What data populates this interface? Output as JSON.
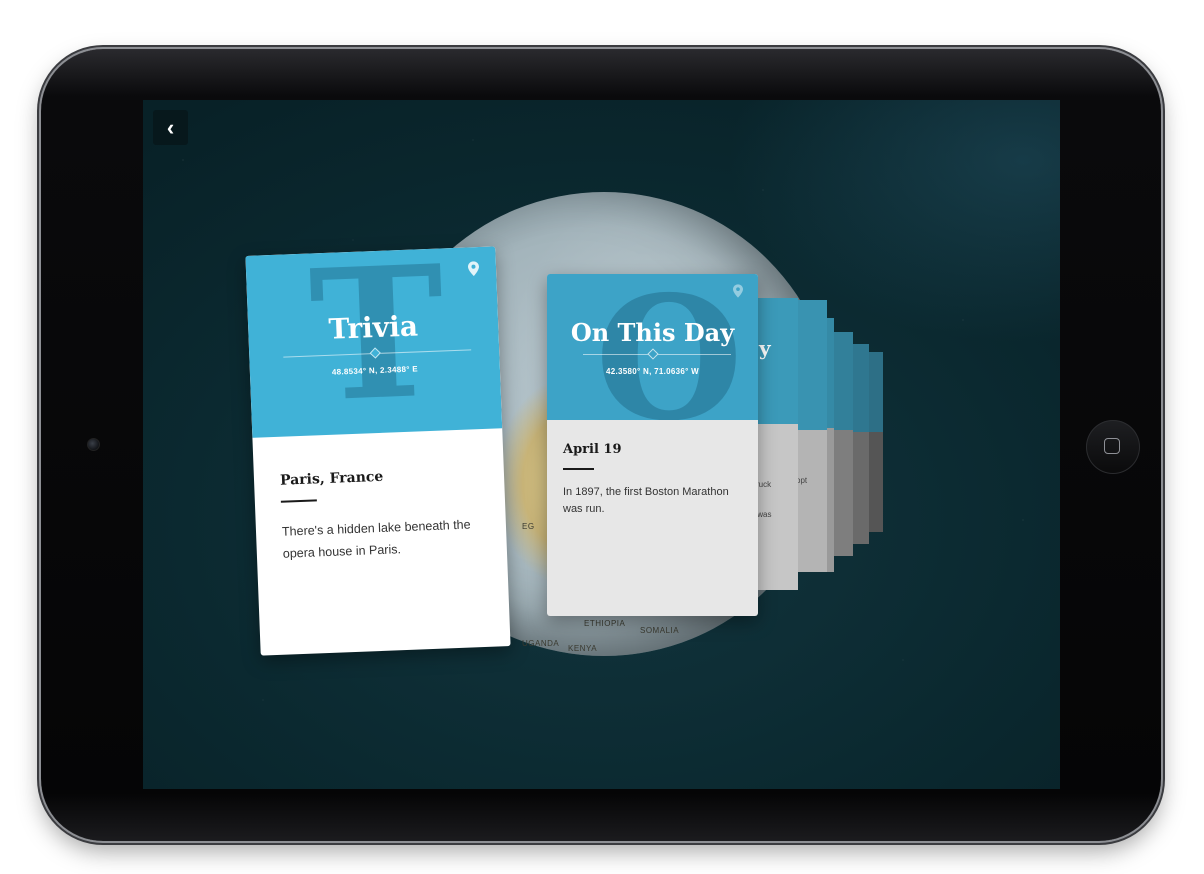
{
  "app": {
    "back_glyph": "‹",
    "back_icon": "chevron-left-icon",
    "pin_icon": "map-pin-icon",
    "accent_color": "#3fb0d4"
  },
  "globe_labels": [
    "ETHIOPIA",
    "SOMALIA",
    "UGANDA",
    "KENYA",
    "EG"
  ],
  "cards": [
    {
      "id": "trivia",
      "letter": "T",
      "title": "Trivia",
      "coords": "48.8534° N, 2.3488° E",
      "place": "Paris, France",
      "fact": "There's a hidden lake beneath the opera house in Paris."
    },
    {
      "id": "on-this-day",
      "letter": "O",
      "title": "On This Day",
      "coords": "42.3580° N, 71.0636° W",
      "place": "April 19",
      "fact": "In 1897, the first Boston Marathon was run."
    }
  ],
  "stack_peek": {
    "title_fragment": "y",
    "line1": "ruck",
    "line2": "y was",
    "line3": "opt"
  }
}
